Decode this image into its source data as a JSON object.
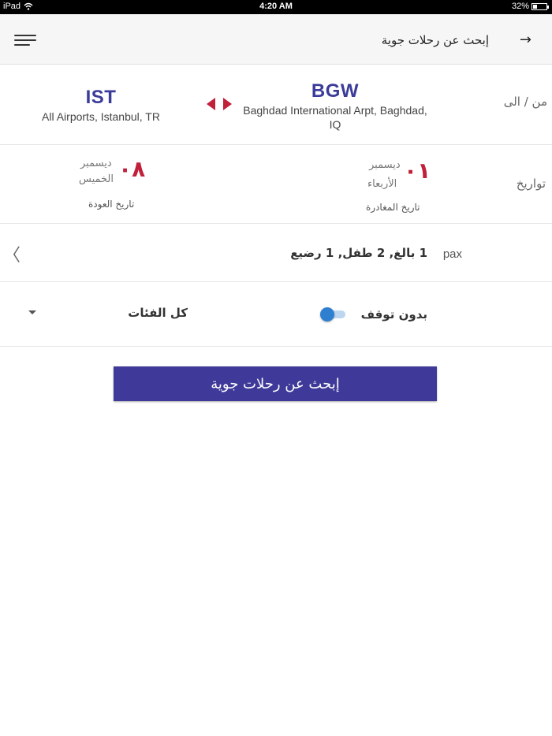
{
  "status_bar": {
    "device": "iPad",
    "time": "4:20 AM",
    "battery": "32%",
    "battery_level": 0.32,
    "wifi_icon": "wifi-icon"
  },
  "header": {
    "title": "إبحث عن رحلات جوية",
    "menu_icon": "hamburger-menu-icon",
    "back_icon": "arrow-right-icon",
    "back_glyph": "→"
  },
  "route": {
    "label": "من / الى",
    "from": {
      "code": "BGW",
      "name_line1": "Baghdad International Arpt, Baghdad,",
      "name_line2": "IQ"
    },
    "to": {
      "code": "IST",
      "name": "All Airports, Istanbul, TR"
    },
    "swap_icon": "swap-arrows-icon",
    "accent_color": "#c0203a",
    "code_color": "#3b3b9a"
  },
  "dates": {
    "label": "تواريخ",
    "departure": {
      "day_num": "٠١",
      "month": "ديسمبر",
      "weekday": "الأربعاء",
      "caption": "تاريخ المغادرة"
    },
    "return": {
      "day_num": "٠٨",
      "month": "ديسمبر",
      "weekday": "الخميس",
      "caption": "تاريخ العودة"
    }
  },
  "passengers": {
    "label": "pax",
    "value": "1 بالغ, 2 طفل, 1 رضيع",
    "chevron_glyph": "〈",
    "chevron_icon": "chevron-left-icon"
  },
  "options": {
    "nonstop_label": "بدون توقف",
    "nonstop_enabled": false,
    "class_value": "كل الفئات",
    "class_caret_icon": "dropdown-caret-icon"
  },
  "search_button": {
    "label": "إبحث عن رحلات جوية",
    "color": "#3f3a99"
  }
}
